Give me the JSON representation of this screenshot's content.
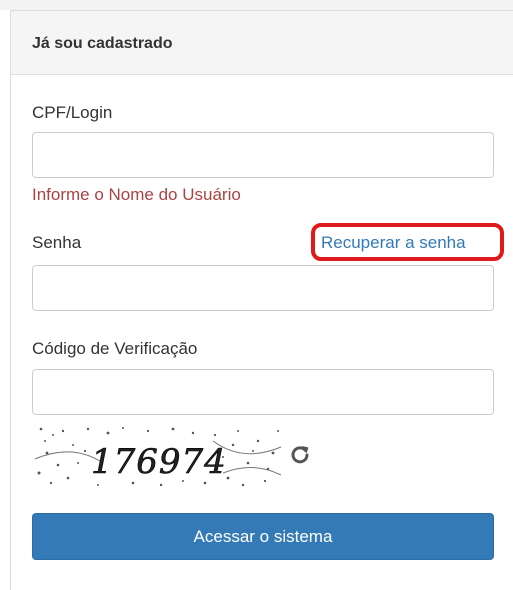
{
  "panel": {
    "title": "Já sou cadastrado"
  },
  "login": {
    "label": "CPF/Login",
    "value": "",
    "placeholder": "",
    "error": "Informe o Nome do Usuário"
  },
  "password": {
    "label": "Senha",
    "value": "",
    "placeholder": "",
    "recover_link": "Recuperar a senha"
  },
  "verification": {
    "label": "Código de Verificação",
    "value": "",
    "placeholder": "",
    "captcha_text": "176974",
    "refresh_icon": "refresh-icon"
  },
  "submit": {
    "label": "Acessar o sistema"
  },
  "colors": {
    "primary": "#337ab7",
    "error": "#a94442",
    "link": "#337ab7",
    "highlight": "#e01a1a"
  }
}
